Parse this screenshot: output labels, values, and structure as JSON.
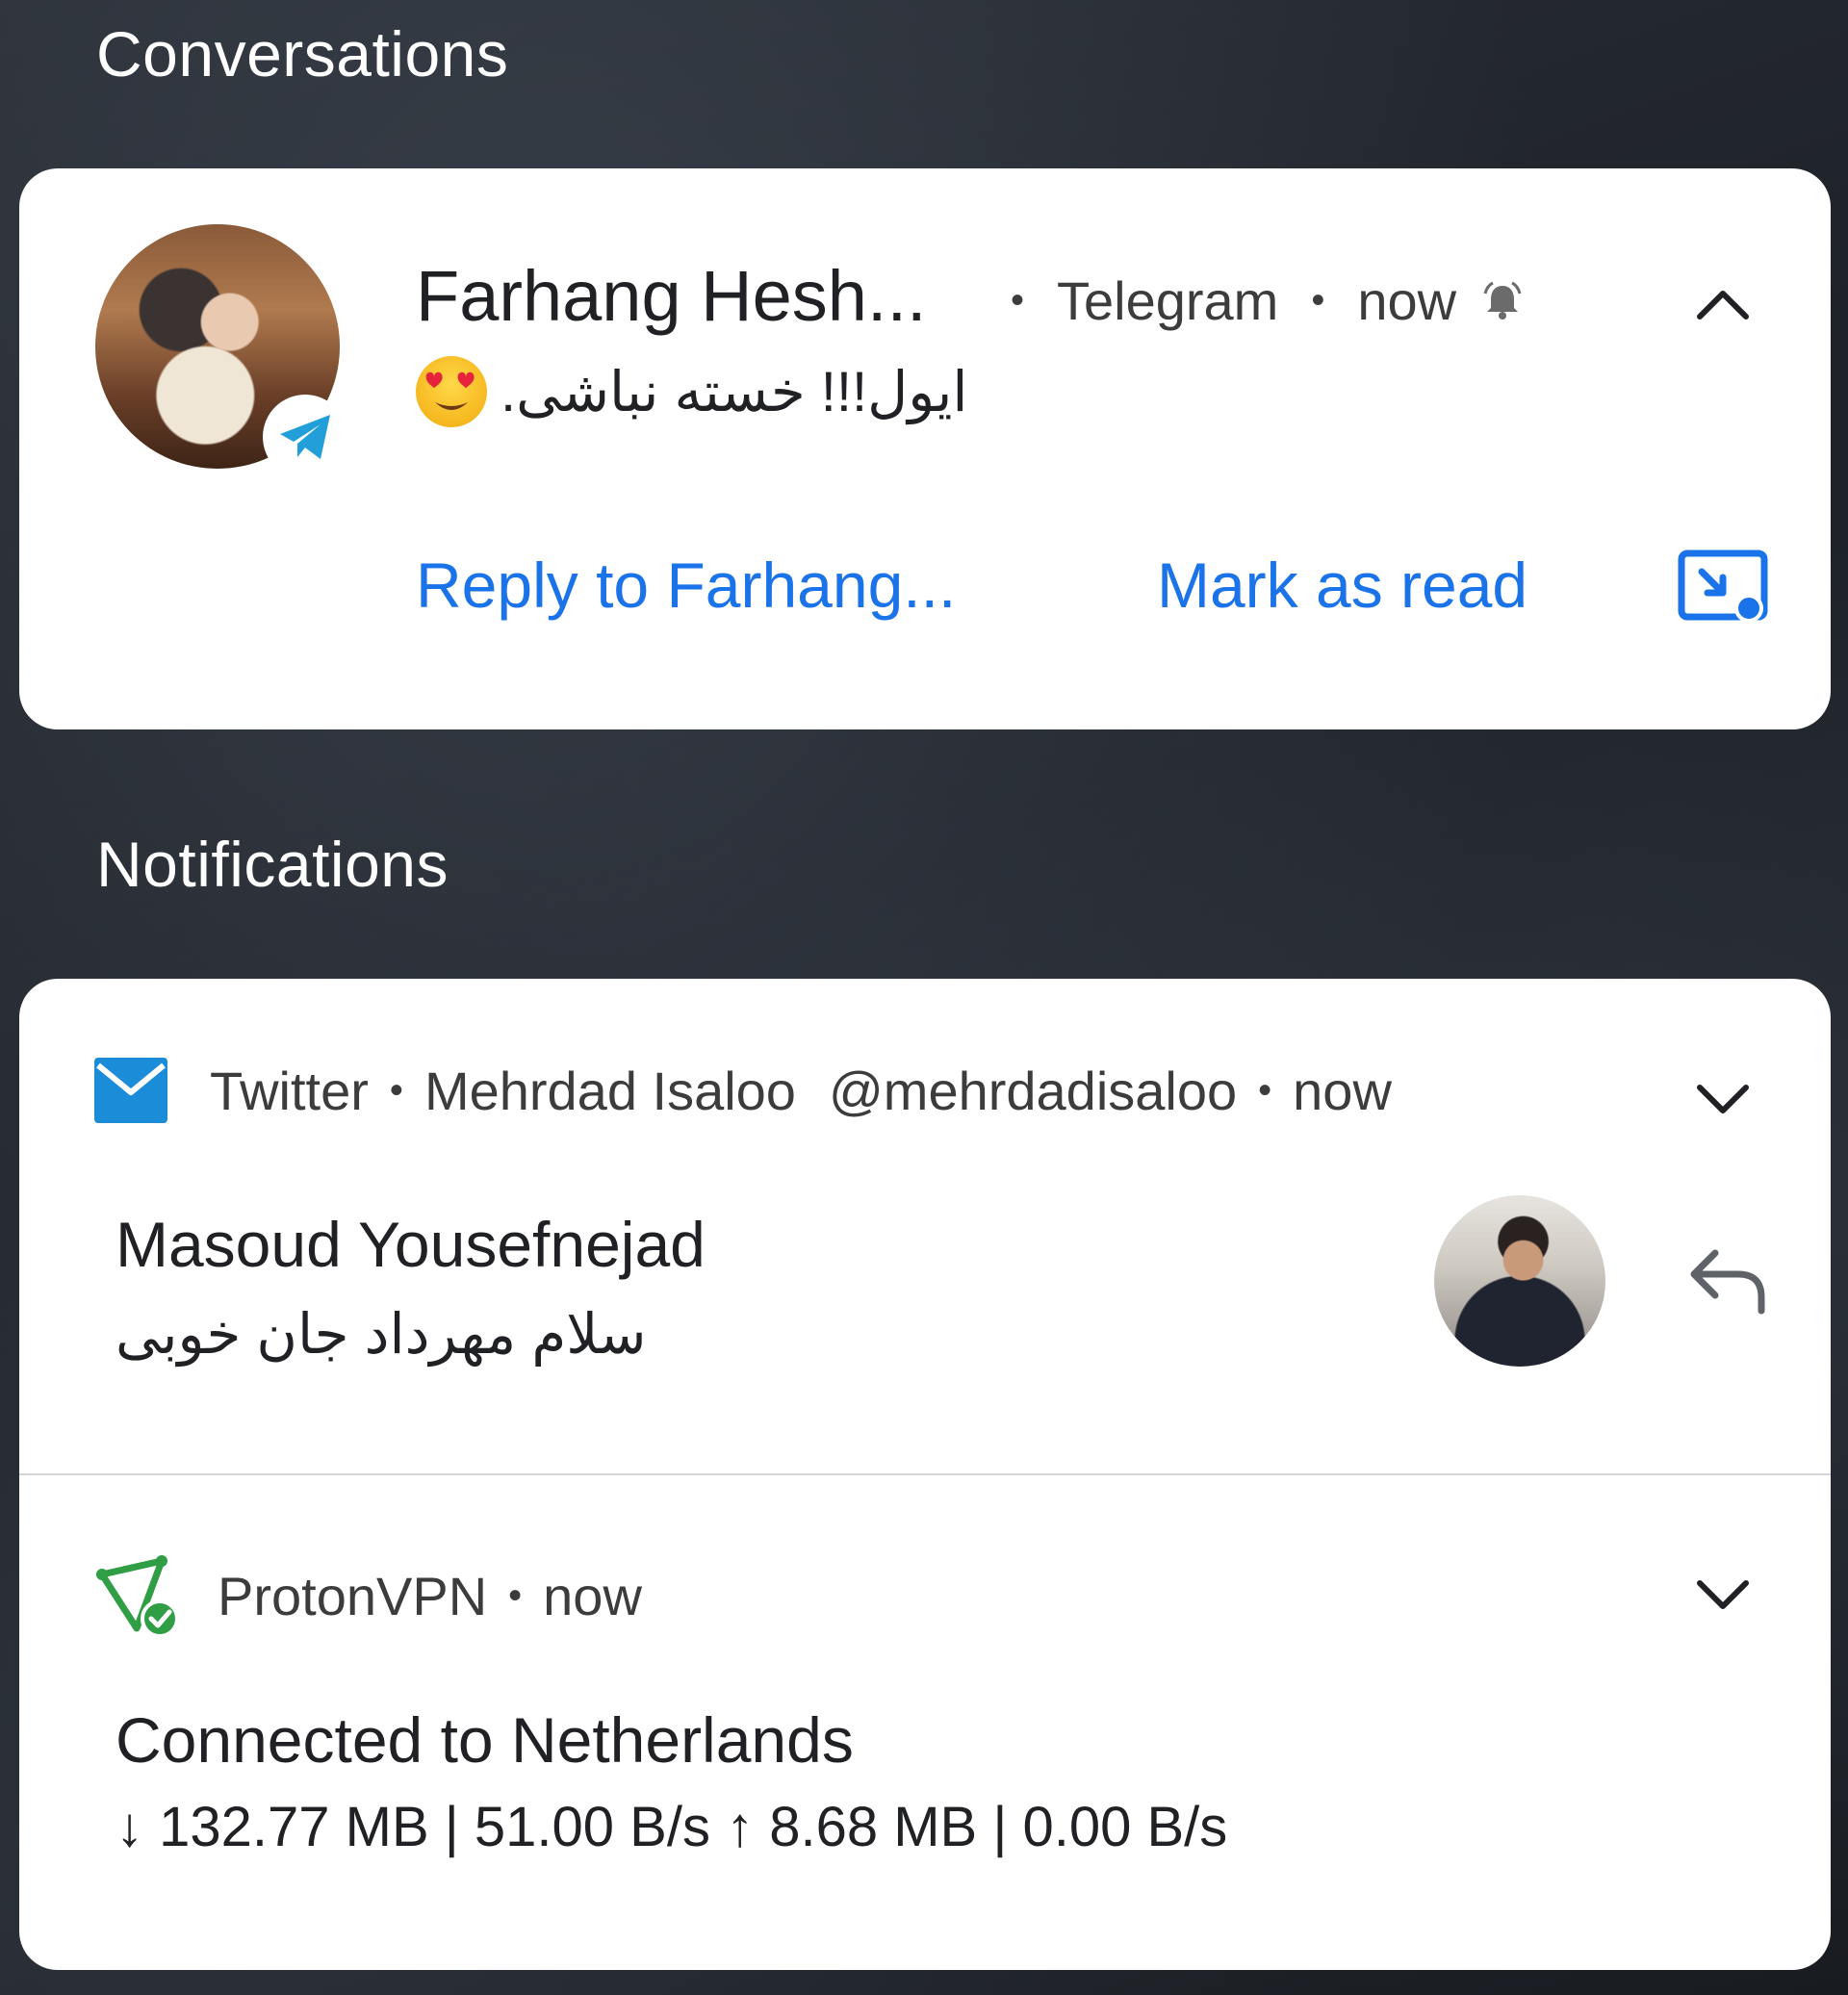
{
  "sections": {
    "conversations_title": "Conversations",
    "notifications_title": "Notifications"
  },
  "conversation": {
    "sender": "Farhang Hesh...",
    "app": "Telegram",
    "time": "now",
    "message_text": "ایول!!! خسته نباشی.",
    "emoji": "heart-eyes-emoji",
    "bell_icon": "bell-icon",
    "chevron_icon": "chevron-up-icon",
    "actions": {
      "reply": "Reply to Farhang...",
      "mark_read": "Mark as read",
      "bubble_icon": "bubble-icon"
    },
    "accent_color": "#1a73e8"
  },
  "twitter": {
    "app": "Twitter",
    "account_name": "Mehrdad Isaloo",
    "handle": "@mehrdadisaloo",
    "time": "now",
    "title": "Masoud Yousefnejad",
    "text": "سلام مهرداد جان خوبی",
    "icon": "mail-icon",
    "icon_color": "#1a8cd8",
    "chevron_icon": "chevron-down-icon",
    "reply_icon": "reply-icon"
  },
  "vpn": {
    "app": "ProtonVPN",
    "time": "now",
    "title": "Connected to Netherlands",
    "stats": "↓ 132.77 MB | 51.00 B/s ↑ 8.68 MB | 0.00 B/s",
    "icon": "protonvpn-icon",
    "icon_color": "#2f9e44",
    "chevron_icon": "chevron-down-icon"
  }
}
